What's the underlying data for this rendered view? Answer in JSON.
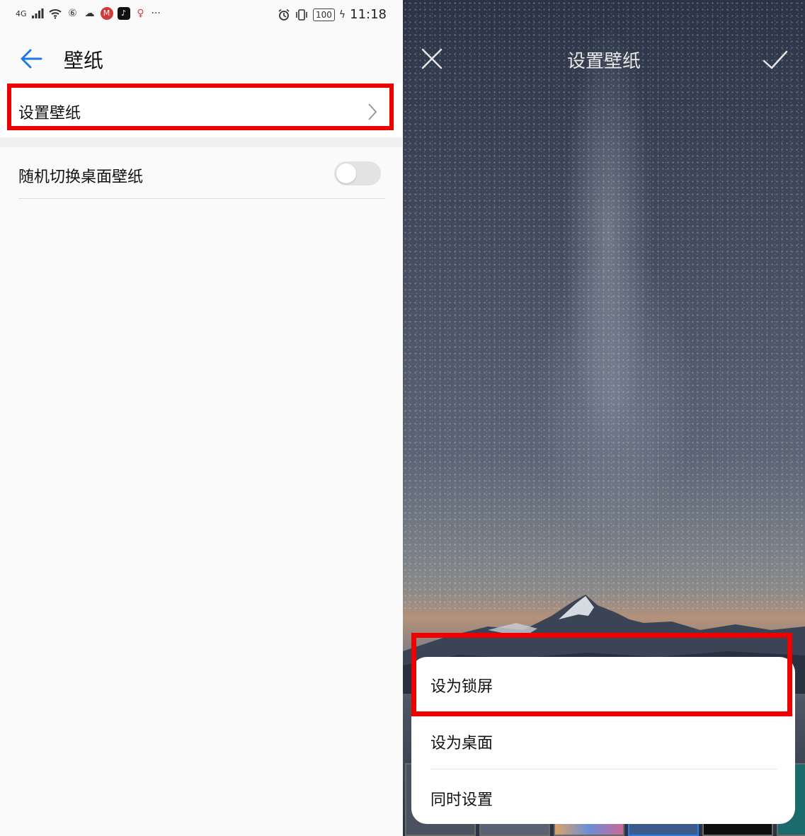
{
  "left": {
    "status_bar": {
      "network": "4G",
      "time": "11:18",
      "battery": "100",
      "more": "···"
    },
    "header": {
      "title": "壁纸"
    },
    "rows": {
      "set_wallpaper": "设置壁纸",
      "random_switch": "随机切换桌面壁纸"
    },
    "toggle_random_on": false
  },
  "right": {
    "header": {
      "title": "设置壁纸"
    },
    "sheet": {
      "options": [
        "设为锁屏",
        "设为桌面",
        "同时设置"
      ]
    }
  },
  "colors": {
    "highlight": "#ee0000",
    "accent": "#1e7be5"
  },
  "icons": [
    "back-arrow-icon",
    "chevron-right-icon",
    "close-icon",
    "check-icon",
    "wifi-icon",
    "signal-icon",
    "alarm-icon",
    "vibrate-icon",
    "battery-icon"
  ]
}
